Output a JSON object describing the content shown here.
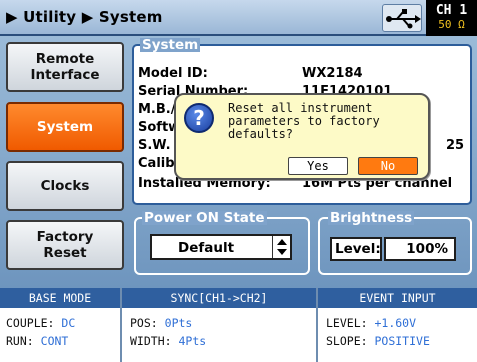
{
  "header": {
    "breadcrumb": "▶ Utility ▶ System",
    "usb_icon": "usb-icon",
    "channel": "CH 1",
    "impedance": "50 Ω"
  },
  "sidebar": {
    "items": [
      {
        "label": "Remote\nInterface",
        "active": false
      },
      {
        "label": "System",
        "active": true
      },
      {
        "label": "Clocks",
        "active": false
      },
      {
        "label": "Factory\nReset",
        "active": false
      }
    ]
  },
  "system": {
    "title": "System",
    "rows": [
      {
        "label": "Model ID:",
        "value": "WX2184"
      },
      {
        "label": "Serial Number:",
        "value": "11E1420101"
      },
      {
        "label": "M.B./",
        "value": ""
      },
      {
        "label": "Softw",
        "value": ""
      },
      {
        "label": "S.W.",
        "value": "25"
      },
      {
        "label": "Calib",
        "value": ""
      },
      {
        "label": "Installed Memory:",
        "value": "16M Pts per channel"
      }
    ]
  },
  "power_on": {
    "title": "Power ON State",
    "value": "Default"
  },
  "brightness": {
    "title": "Brightness",
    "label": "Level:",
    "value": "100%"
  },
  "dialog": {
    "message": "Reset all instrument parameters to factory defaults?",
    "yes_label": "Yes",
    "no_label": "No"
  },
  "status": {
    "base_mode": {
      "title": "BASE MODE",
      "couple_label": "COUPLE:",
      "couple_value": "DC",
      "run_label": "RUN:",
      "run_value": "CONT"
    },
    "sync": {
      "title": "SYNC[CH1->CH2]",
      "pos_label": "POS:",
      "pos_value": "0Pts",
      "width_label": "WIDTH:",
      "width_value": "4Pts"
    },
    "event": {
      "title": "EVENT INPUT",
      "level_label": "LEVEL:",
      "level_value": "+1.60V",
      "slope_label": "SLOPE:",
      "slope_value": "POSITIVE"
    }
  },
  "colors": {
    "accent_orange": "#f05a00",
    "header_blue": "#2f5f9f",
    "value_blue": "#2f6fd6"
  }
}
